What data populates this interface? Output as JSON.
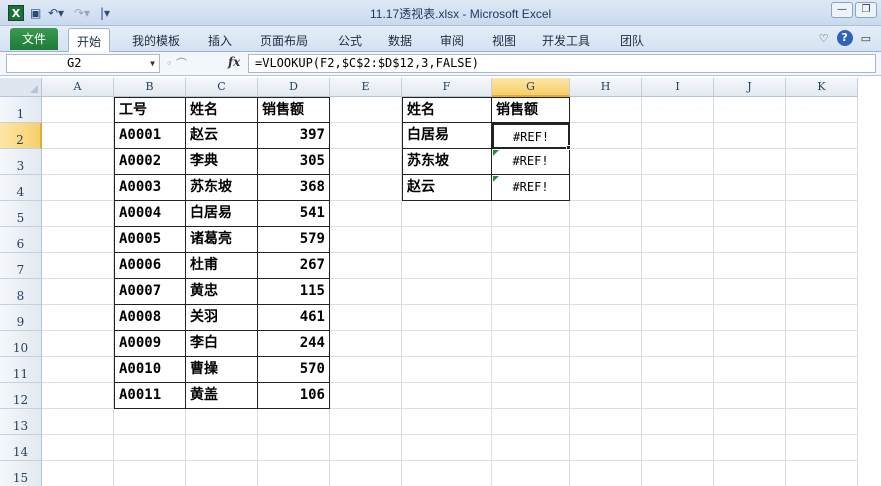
{
  "window": {
    "title": "11.17透视表.xlsx - Microsoft Excel",
    "app_icon": "X"
  },
  "ribbon": {
    "file_tab": "文件",
    "tabs": [
      "开始",
      "我的模板",
      "插入",
      "页面布局",
      "公式",
      "数据",
      "审阅",
      "视图",
      "开发工具",
      "团队"
    ],
    "active_tab": "开始"
  },
  "formula_bar": {
    "name_box": "G2",
    "fx": "fx",
    "formula": "=VLOOKUP(F2,$C$2:$D$12,3,FALSE)"
  },
  "columns": [
    "A",
    "B",
    "C",
    "D",
    "E",
    "F",
    "G",
    "H",
    "I",
    "J",
    "K"
  ],
  "rows": [
    "1",
    "2",
    "3",
    "4",
    "5",
    "6",
    "7",
    "8",
    "9",
    "10",
    "11",
    "12",
    "13",
    "14",
    "15"
  ],
  "selected_cell": "G2",
  "table1": {
    "headers": [
      "工号",
      "姓名",
      "销售额"
    ],
    "rows": [
      [
        "A0001",
        "赵云",
        "397"
      ],
      [
        "A0002",
        "李典",
        "305"
      ],
      [
        "A0003",
        "苏东坡",
        "368"
      ],
      [
        "A0004",
        "白居易",
        "541"
      ],
      [
        "A0005",
        "诸葛亮",
        "579"
      ],
      [
        "A0006",
        "杜甫",
        "267"
      ],
      [
        "A0007",
        "黄忠",
        "115"
      ],
      [
        "A0008",
        "关羽",
        "461"
      ],
      [
        "A0009",
        "李白",
        "244"
      ],
      [
        "A0010",
        "曹操",
        "570"
      ],
      [
        "A0011",
        "黄盖",
        "106"
      ]
    ]
  },
  "table2": {
    "headers": [
      "姓名",
      "销售额"
    ],
    "rows": [
      [
        "白居易",
        "#REF!"
      ],
      [
        "苏东坡",
        "#REF!"
      ],
      [
        "赵云",
        "#REF!"
      ]
    ]
  },
  "colors": {
    "file_tab": "#1f7a37",
    "selected_header": "#f6cf6a",
    "gridline": "#dadfe6"
  }
}
